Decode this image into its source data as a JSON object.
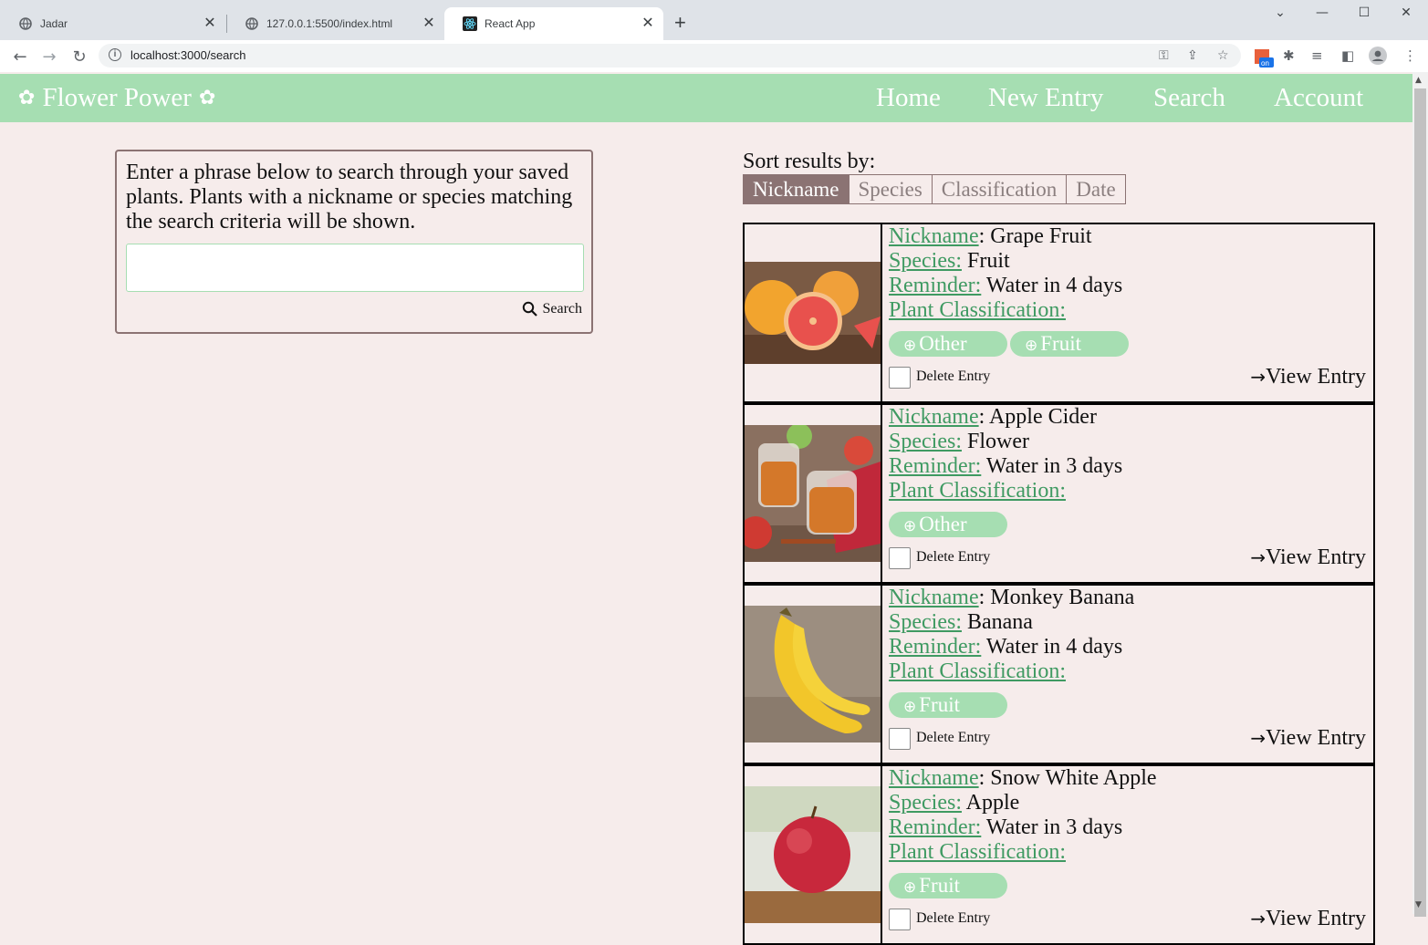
{
  "browser": {
    "tabs": [
      {
        "title": "Jadar",
        "icon": "globe-icon"
      },
      {
        "title": "127.0.0.1:5500/index.html",
        "icon": "globe-icon"
      },
      {
        "title": "React App",
        "icon": "react-icon"
      }
    ],
    "url": "localhost:3000/search"
  },
  "app": {
    "brand": "Flower Power",
    "nav": [
      "Home",
      "New Entry",
      "Search",
      "Account"
    ],
    "colors": {
      "nav_bg": "#a6deb2",
      "page_bg": "#f6eceb",
      "accent": "#8b7373",
      "link": "#3f9a62"
    }
  },
  "search": {
    "instructions": "Enter a phrase below to search through your saved plants. Plants with a nickname or species matching the search criteria will be shown.",
    "input_value": "",
    "button_label": "Search"
  },
  "sort": {
    "label": "Sort results by:",
    "options": [
      "Nickname",
      "Species",
      "Classification",
      "Date"
    ],
    "active": "Nickname"
  },
  "labels": {
    "nickname": "Nickname",
    "species": "Species:",
    "reminder": "Reminder:",
    "classification": "Plant Classification:",
    "delete": "Delete Entry",
    "view": "View Entry"
  },
  "entries": [
    {
      "nickname": "Grape Fruit",
      "species": "Fruit",
      "reminder": "Water in 4 days",
      "tags": [
        "Other",
        "Fruit"
      ],
      "image": "grapefruit-photo"
    },
    {
      "nickname": "Apple Cider",
      "species": "Flower",
      "reminder": "Water in 3 days",
      "tags": [
        "Other"
      ],
      "image": "apple-cider-photo"
    },
    {
      "nickname": "Monkey Banana",
      "species": "Banana",
      "reminder": "Water in 4 days",
      "tags": [
        "Fruit"
      ],
      "image": "banana-photo"
    },
    {
      "nickname": "Snow White Apple",
      "species": "Apple",
      "reminder": "Water in 3 days",
      "tags": [
        "Fruit"
      ],
      "image": "apple-photo"
    }
  ]
}
